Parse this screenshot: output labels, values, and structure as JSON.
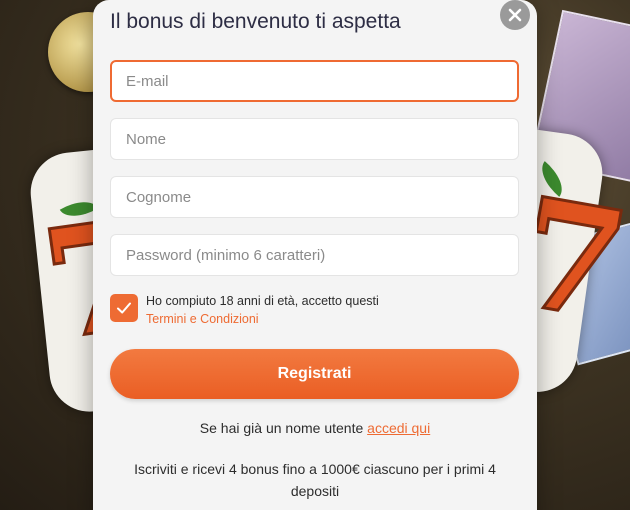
{
  "modal": {
    "title": "Il bonus di benvenuto ti aspetta",
    "close_icon": "close-icon"
  },
  "form": {
    "email_placeholder": "E-mail",
    "email_value": "",
    "name_placeholder": "Nome",
    "name_value": "",
    "surname_placeholder": "Cognome",
    "surname_value": "",
    "password_placeholder": "Password (minimo 6 caratteri)",
    "password_value": "",
    "consent": {
      "checked": true,
      "text": "Ho compiuto 18 anni di età, accetto questi",
      "link_label": "Termini e Condizioni",
      "check_icon": "checkmark-icon"
    },
    "submit_label": "Registrati"
  },
  "login": {
    "prompt": "Se hai già un nome utente",
    "link_label": "accedi qui"
  },
  "promo_text": "Iscriviti e ricevi 4 bonus fino a 1000€ ciascuno per i primi 4 depositi",
  "colors": {
    "accent": "#ee6b33",
    "modal_bg": "#f4f4f4",
    "title": "#2d2d44",
    "close_bg": "#9a9a9a"
  }
}
